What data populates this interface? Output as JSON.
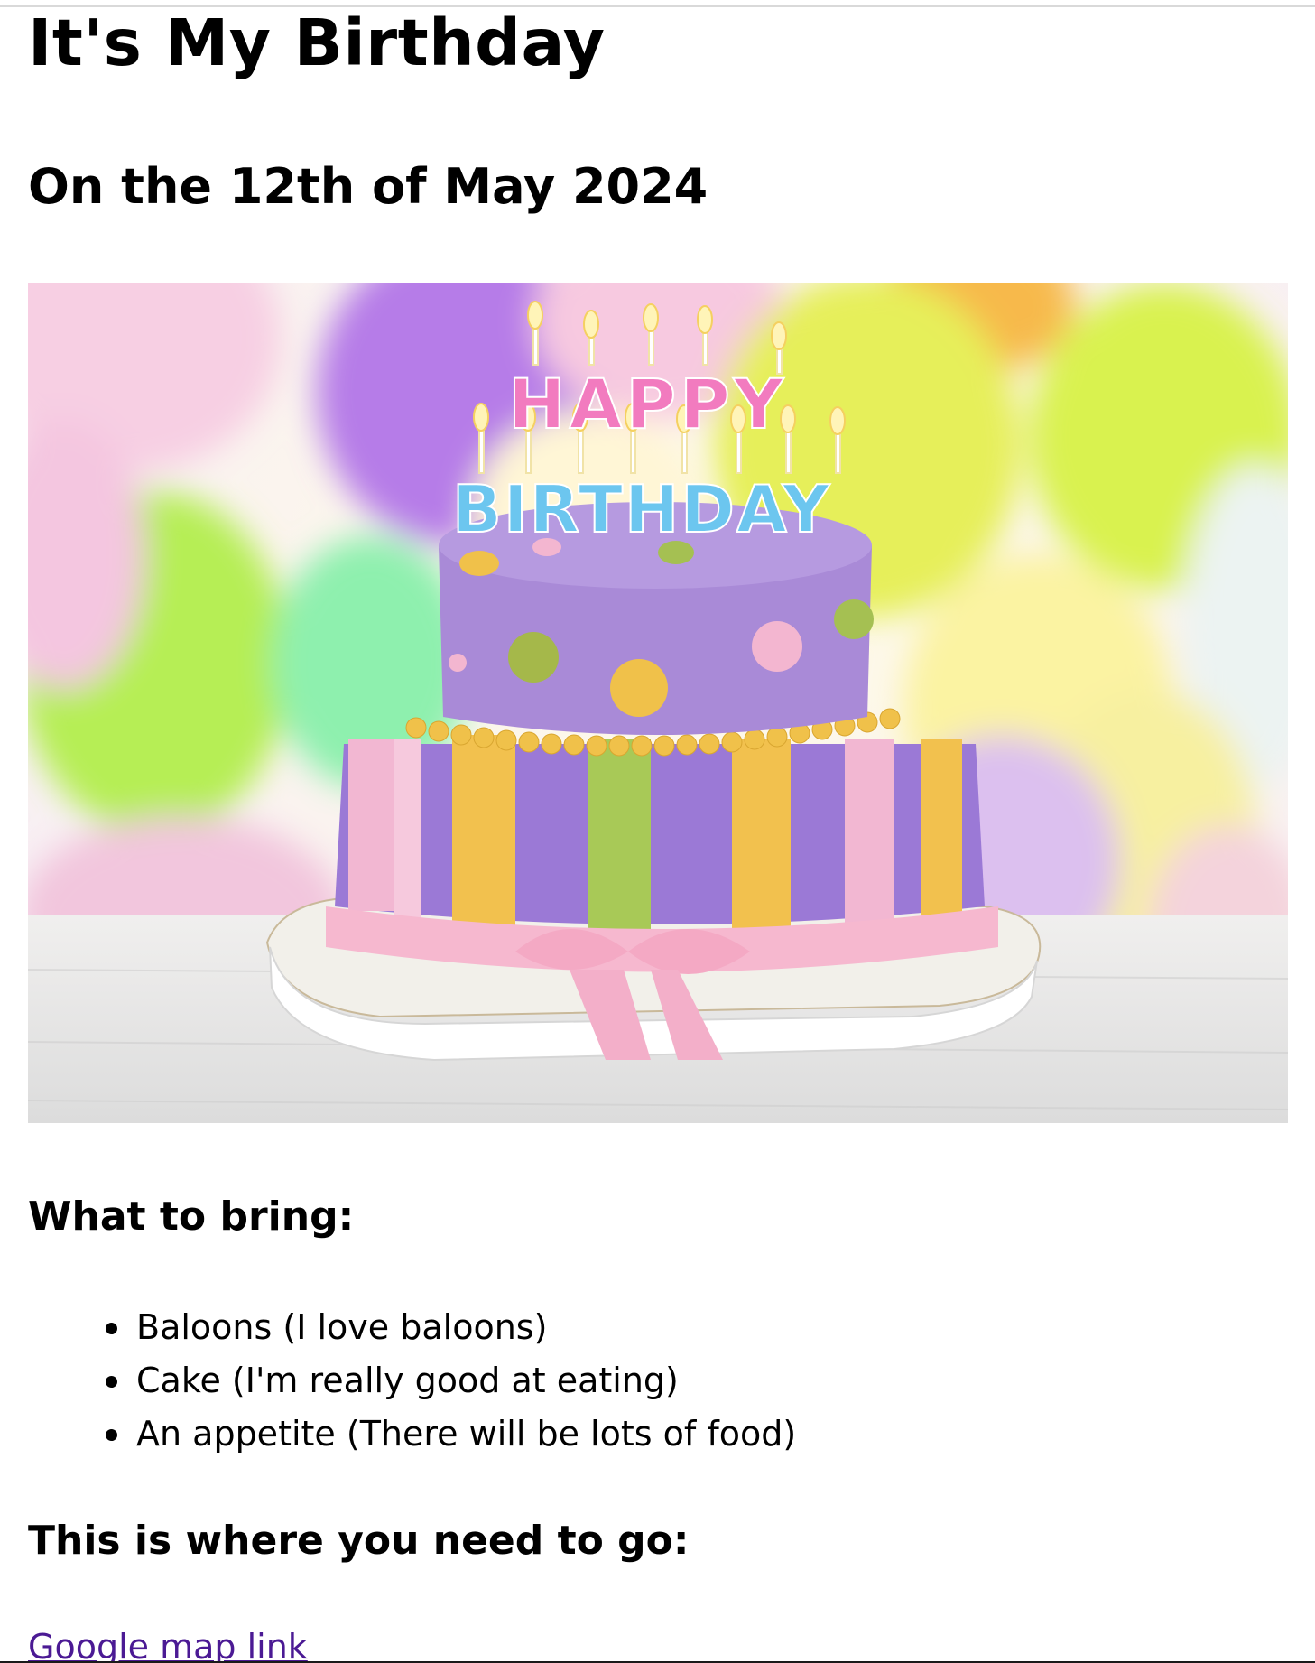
{
  "page": {
    "title": "It's My Birthday",
    "subtitle": "On the 12th of May 2024"
  },
  "hero_image": {
    "description_alt": "Birthday cake",
    "candle_text_top": "HAPPY",
    "candle_text_bottom": "BIRTHDAY"
  },
  "bring_section": {
    "heading": "What to bring:",
    "items": [
      "Baloons (I love baloons)",
      "Cake (I'm really good at eating)",
      "An appetite (There will be lots of food)"
    ]
  },
  "location_section": {
    "heading": "This is where you need to go:",
    "link_text": "Google map link"
  },
  "colors": {
    "link": "#4b1a94",
    "text": "#000000"
  }
}
